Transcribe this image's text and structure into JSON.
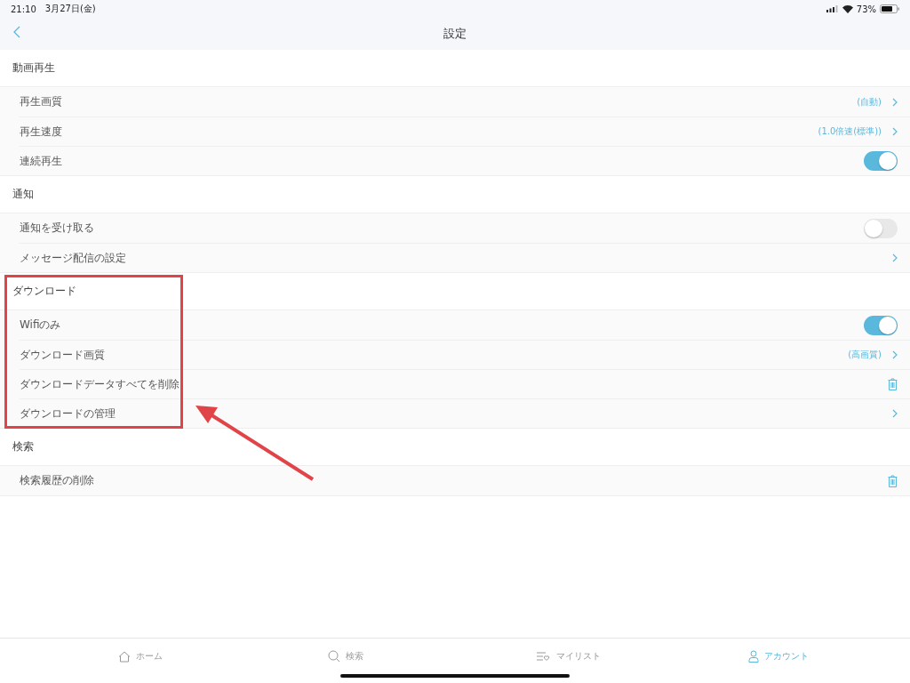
{
  "status_bar": {
    "time": "21:10",
    "date": "3月27日(金)",
    "battery": "73%"
  },
  "nav": {
    "title": "設定"
  },
  "sections": [
    {
      "title": "動画再生",
      "rows": [
        {
          "kind": "value",
          "label": "再生画質",
          "value": "(自動)"
        },
        {
          "kind": "value",
          "label": "再生速度",
          "value": "(1.0倍速(標準))"
        },
        {
          "kind": "toggle",
          "label": "連続再生",
          "on": true
        }
      ]
    },
    {
      "title": "通知",
      "rows": [
        {
          "kind": "toggle",
          "label": "通知を受け取る",
          "on": false
        },
        {
          "kind": "chevron",
          "label": "メッセージ配信の設定"
        }
      ]
    },
    {
      "title": "ダウンロード",
      "rows": [
        {
          "kind": "toggle",
          "label": "Wifiのみ",
          "on": true
        },
        {
          "kind": "value",
          "label": "ダウンロード画質",
          "value": "(高画質)"
        },
        {
          "kind": "trash",
          "label": "ダウンロードデータすべてを削除"
        },
        {
          "kind": "chevron",
          "label": "ダウンロードの管理"
        }
      ]
    },
    {
      "title": "検索",
      "rows": [
        {
          "kind": "trash",
          "label": "検索履歴の削除"
        }
      ]
    }
  ],
  "tab_bar": [
    {
      "kind": "home",
      "label": "ホーム",
      "selected": false
    },
    {
      "kind": "search",
      "label": "検索",
      "selected": false
    },
    {
      "kind": "mylist",
      "label": "マイリスト",
      "selected": false
    },
    {
      "kind": "account",
      "label": "アカウント",
      "selected": true
    }
  ]
}
